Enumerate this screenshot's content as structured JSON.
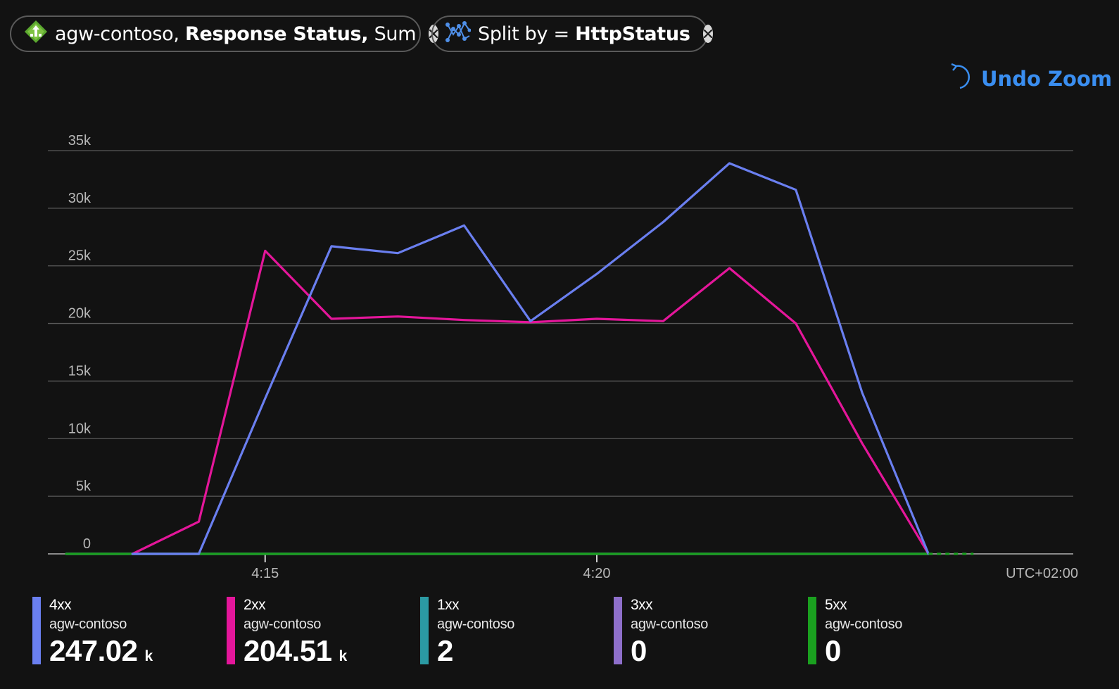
{
  "filters": {
    "metric_pill": {
      "icon": "app-gateway-icon",
      "resource": "agw-contoso,",
      "metric": "Response Status,",
      "aggregation": "Sum"
    },
    "split_pill": {
      "icon": "split-graph-icon",
      "prefix": "Split by =",
      "dimension": "HttpStatus"
    }
  },
  "undo_zoom": {
    "label": "Undo Zoom",
    "icon": "undo-icon"
  },
  "chart_data": {
    "type": "line",
    "x": [
      "4:12",
      "4:13",
      "4:14",
      "4:15",
      "4:16",
      "4:17",
      "4:18",
      "4:19",
      "4:20",
      "4:21",
      "4:22",
      "4:23",
      "4:24",
      "4:25",
      "4:26"
    ],
    "x_ticks": [
      "4:15",
      "4:20"
    ],
    "y_ticks": [
      "0",
      "5k",
      "10k",
      "15k",
      "20k",
      "25k",
      "30k",
      "35k"
    ],
    "ylim": [
      0,
      35000
    ],
    "timezone_label": "UTC+02:00",
    "grid": true,
    "legend_position": "bottom",
    "series": [
      {
        "name": "4xx",
        "color": "#6a7ff0",
        "values": [
          null,
          0,
          0,
          13500,
          26700,
          26100,
          28500,
          20200,
          24300,
          28800,
          33900,
          31600,
          14000,
          0,
          null
        ]
      },
      {
        "name": "2xx",
        "color": "#e4169a",
        "values": [
          null,
          0,
          2800,
          26300,
          20400,
          20600,
          20300,
          20100,
          20400,
          20200,
          24800,
          20000,
          9600,
          0,
          null
        ]
      },
      {
        "name": "1xx",
        "color": "#2b9aa3",
        "values": [
          0,
          0,
          0,
          0,
          0,
          0,
          0,
          0,
          0,
          0,
          0,
          0,
          0,
          0,
          null
        ]
      },
      {
        "name": "3xx",
        "color": "#8e6fcb",
        "values": [
          0,
          0,
          0,
          0,
          0,
          0,
          0,
          0,
          0,
          0,
          0,
          0,
          0,
          0,
          null
        ]
      },
      {
        "name": "5xx",
        "color": "#1aa01f",
        "values": [
          0,
          0,
          0,
          0,
          0,
          0,
          0,
          0,
          0,
          0,
          0,
          0,
          0,
          0,
          null
        ]
      }
    ]
  },
  "legend": [
    {
      "name": "4xx",
      "resource": "agw-contoso",
      "value": "247.02",
      "unit": "k",
      "color": "#6a7ff0"
    },
    {
      "name": "2xx",
      "resource": "agw-contoso",
      "value": "204.51",
      "unit": "k",
      "color": "#e4169a"
    },
    {
      "name": "1xx",
      "resource": "agw-contoso",
      "value": "2",
      "unit": "",
      "color": "#2b9aa3"
    },
    {
      "name": "3xx",
      "resource": "agw-contoso",
      "value": "0",
      "unit": "",
      "color": "#8e6fcb"
    },
    {
      "name": "5xx",
      "resource": "agw-contoso",
      "value": "0",
      "unit": "",
      "color": "#1aa01f"
    }
  ]
}
